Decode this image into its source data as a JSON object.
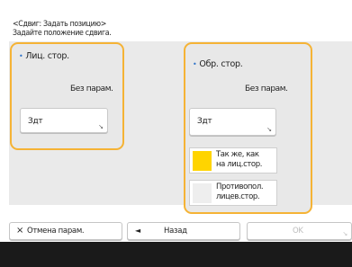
{
  "header": {
    "line1": "<Сдвиг: Задать позицию>",
    "line2": "Задайте положение сдвига."
  },
  "front": {
    "bullet": "•",
    "title": "Лиц. стор.",
    "param_text": "Без парам.",
    "set_label": "Здт",
    "corner": "↘"
  },
  "back": {
    "bullet": "•",
    "title": "Обр. стор.",
    "param_text": "Без парам.",
    "set_label": "Здт",
    "corner": "↘",
    "option_same": {
      "line1": "Так же, как",
      "line2": "на лиц.стор.",
      "color": "#ffd400"
    },
    "option_opposite": {
      "line1": "Противопол.",
      "line2": "лицев.стор.",
      "color": "#eeeeee"
    }
  },
  "bottom": {
    "cancel_icon": "×",
    "cancel_label": "Отмена парам.",
    "back_icon": "◄",
    "back_label": "Назад",
    "ok_label": "OK",
    "ok_corner": "↘"
  },
  "colors": {
    "highlight_border": "#f5b335",
    "accent_blue": "#2f74c9"
  }
}
